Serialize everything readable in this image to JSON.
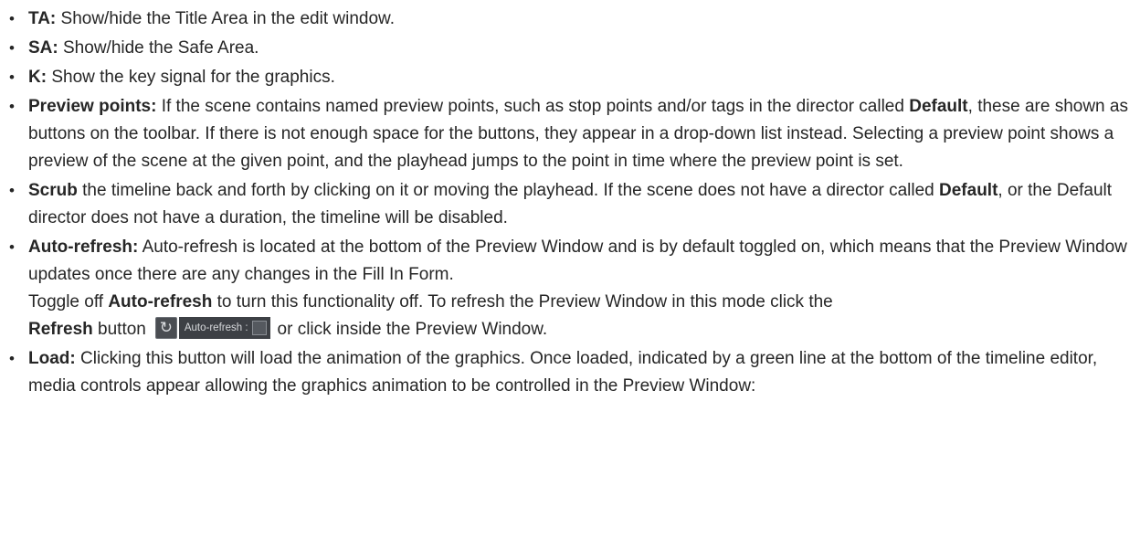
{
  "items": [
    {
      "term": "TA:",
      "text": " Show/hide the Title Area in the edit window."
    },
    {
      "term": "SA:",
      "text": " Show/hide the Safe Area."
    },
    {
      "term": "K:",
      "text": " Show the key signal for the graphics."
    },
    {
      "term": "Preview points:",
      "text_a": " If the scene contains named preview points, such as stop points and/or tags in the director called ",
      "bold_a": "Default",
      "text_b": ", these are shown as buttons on the toolbar. If there is not enough space for the buttons, they appear in a drop-down list instead. Selecting a preview point shows a preview of the scene at the given point, and the playhead jumps to the point in time where the preview point is set."
    },
    {
      "term": "Scrub",
      "text_a": " the timeline back and forth by clicking on it or moving the playhead. If the scene does not have a director called ",
      "bold_a": "Default",
      "text_b": ", or the Default director does not have a duration, the timeline will be disabled."
    },
    {
      "term": "Auto-refresh:",
      "text_a": " Auto-refresh is located at the bottom of the Preview Window and is by default toggled on, which means that the Preview Window updates once there are any changes in the Fill In Form.",
      "line2_a": "Toggle off ",
      "line2_bold": "Auto-refresh",
      "line2_b": " to turn this functionality off. To refresh the Preview Window in this mode click the",
      "line3_bold": "Refresh",
      "line3_a": " button",
      "line3_b": "or click inside the Preview Window.",
      "widget": {
        "icon": "refresh-icon",
        "label": "Auto-refresh :"
      }
    },
    {
      "term": "Load:",
      "text": " Clicking this button will load the animation of the graphics. Once loaded, indicated by a green line at the bottom of the timeline editor, media controls appear allowing the graphics animation to be controlled in the Preview Window:"
    }
  ]
}
